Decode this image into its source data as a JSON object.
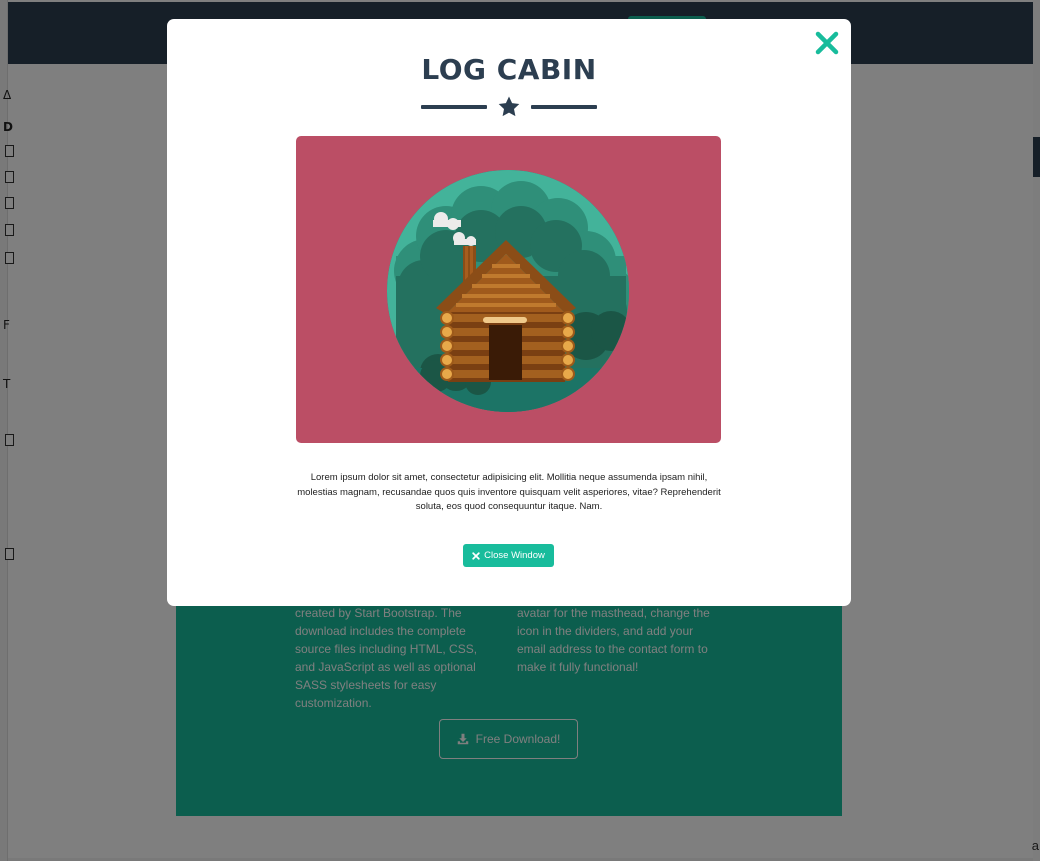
{
  "background": {
    "about": {
      "left_text": "created by Start Bootstrap. The download includes the complete source files including HTML, CSS, and JavaScript as well as optional SASS stylesheets for easy customization.",
      "right_text": "avatar for the masthead, change the icon in the dividers, and add your email address to the contact form to make it fully functional!",
      "download_label": "Free Download!"
    },
    "left_glyphs": [
      "Δ",
      "D",
      "F",
      "T"
    ],
    "right_glyph": "a"
  },
  "modal": {
    "title": "LOG CABIN",
    "divider_icon": "star-icon",
    "image": {
      "subject": "cabin-illustration"
    },
    "body_text": "Lorem ipsum dolor sit amet, consectetur adipisicing elit. Mollitia neque assumenda ipsam nihil, molestias magnam, recusandae quos quis inventore quisquam velit asperiores, vitae? Reprehenderit soluta, eos quod consequuntur itaque. Nam.",
    "close_button_label": "Close Window",
    "close_icon": "close-icon"
  },
  "colors": {
    "primary": "#2c3e50",
    "accent": "#18bc9c",
    "image_background": "#bb4e65"
  }
}
